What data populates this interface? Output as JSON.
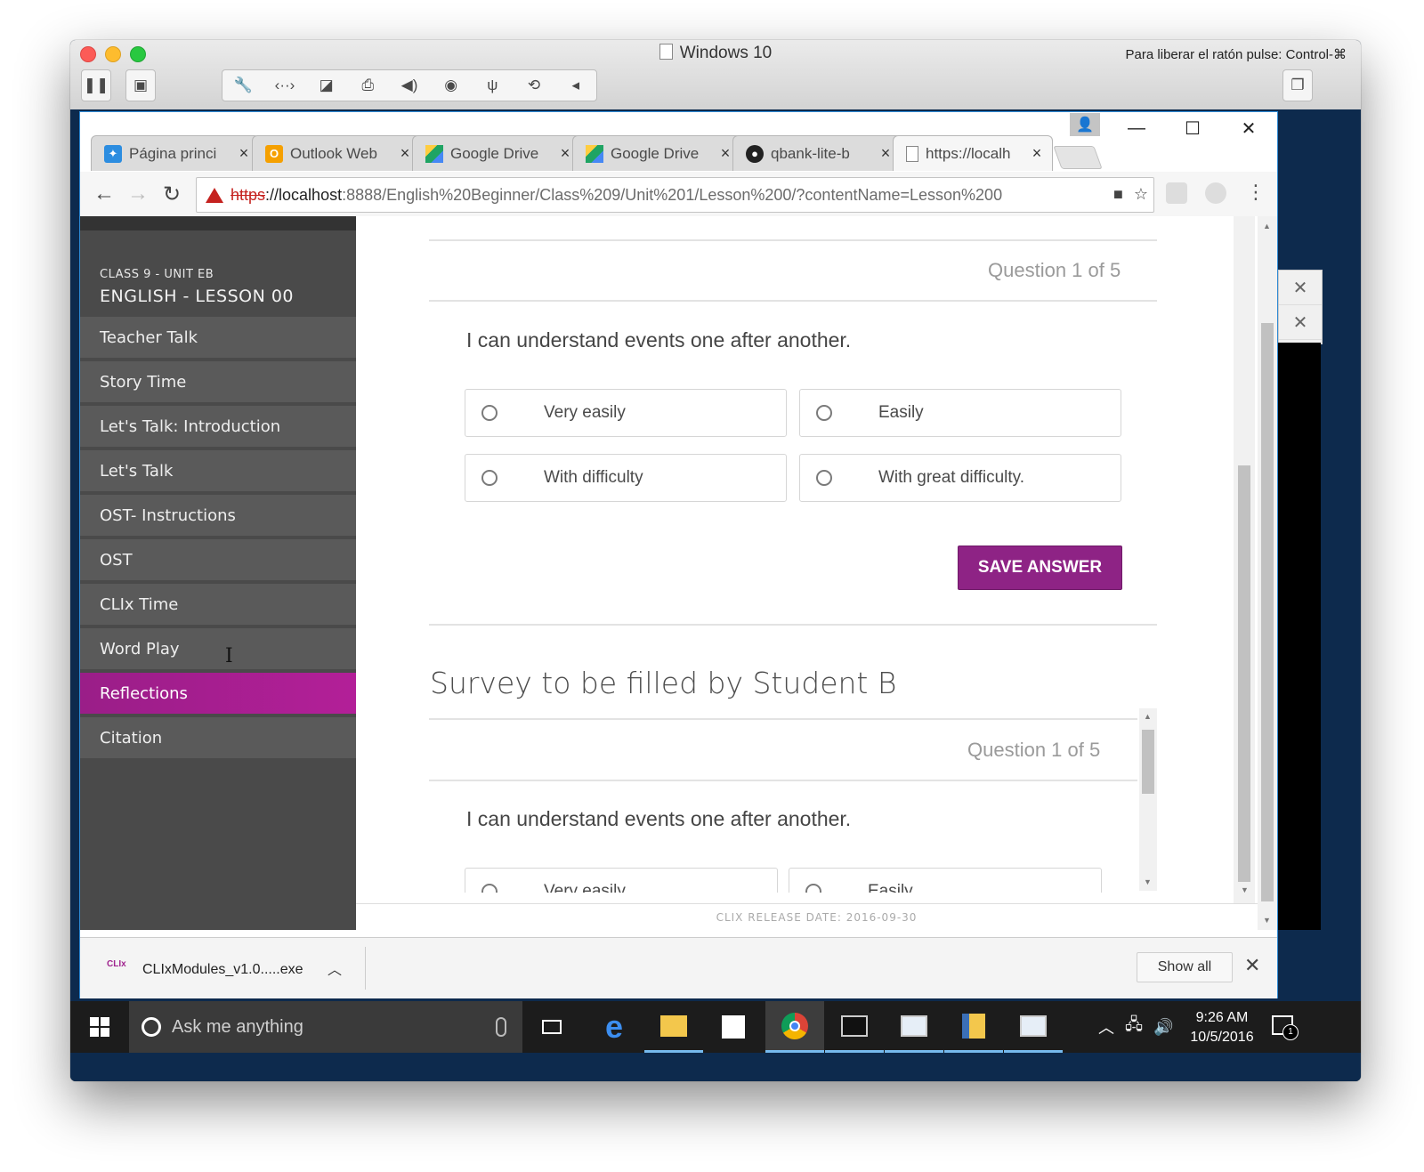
{
  "vm": {
    "title": "Windows 10",
    "hint": "Para liberar el ratón pulse: Control-⌘"
  },
  "browser": {
    "tabs": [
      {
        "label": "Página princi",
        "icon": "dropbox-icon",
        "color": "#2c8de0"
      },
      {
        "label": "Outlook Web",
        "icon": "outlook-icon",
        "color": "#f5a000"
      },
      {
        "label": "Google Drive",
        "icon": "google-drive-icon",
        "color": "#1fa463"
      },
      {
        "label": "Google Drive",
        "icon": "google-drive-icon",
        "color": "#1fa463"
      },
      {
        "label": "qbank-lite-b",
        "icon": "github-icon",
        "color": "#222222"
      },
      {
        "label": "https://localh",
        "icon": "page-icon",
        "color": "#888888"
      }
    ],
    "url": {
      "scheme": "https",
      "host": "://localhost",
      "rest": ":8888/English%20Beginner/Class%209/Unit%201/Lesson%200/?contentName=Lesson%200"
    }
  },
  "sidebar": {
    "class_label": "CLASS 9 - UNIT EB",
    "lesson_label": "ENGLISH - LESSON 00",
    "items": [
      {
        "label": "Teacher Talk"
      },
      {
        "label": "Story Time"
      },
      {
        "label": "Let's Talk: Introduction"
      },
      {
        "label": "Let's Talk"
      },
      {
        "label": "OST- Instructions"
      },
      {
        "label": "OST"
      },
      {
        "label": "CLIx Time"
      },
      {
        "label": "Word Play"
      },
      {
        "label": "Reflections",
        "active": true
      },
      {
        "label": "Citation"
      }
    ]
  },
  "survey_a": {
    "counter": "Question 1 of 5",
    "question": "I can understand events one after another.",
    "options": [
      "Very easily",
      "Easily",
      "With difficulty",
      "With great difficulty."
    ],
    "save_label": "SAVE ANSWER"
  },
  "survey_b": {
    "title": "Survey to be filled by Student B",
    "counter": "Question 1 of 5",
    "question": "I can understand events one after another.",
    "options": [
      "Very easily",
      "Easily"
    ]
  },
  "footer": {
    "release": "CLIX RELEASE DATE: 2016-09-30"
  },
  "download": {
    "icon_text": "CLIx",
    "filename": "CLIxModules_v1.0.....exe",
    "show_all": "Show all"
  },
  "taskbar": {
    "search_placeholder": "Ask me anything",
    "time": "9:26 AM",
    "date": "10/5/2016",
    "notification_count": "1"
  }
}
